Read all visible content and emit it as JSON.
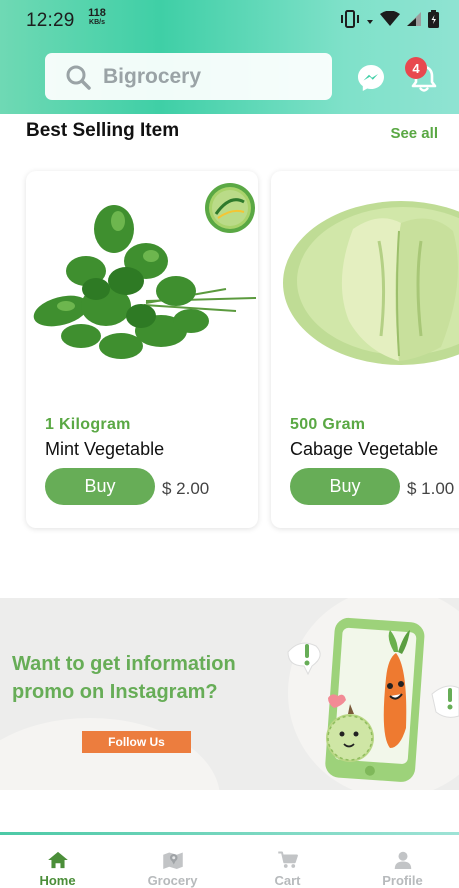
{
  "status_bar": {
    "time": "12:29",
    "net_speed_value": "118",
    "net_speed_unit": "KB/s"
  },
  "header": {
    "search_placeholder": "Bigrocery",
    "notification_count": "4"
  },
  "section": {
    "title": "Best Selling Item",
    "see_all": "See all"
  },
  "products": [
    {
      "weight": "1 Kilogram",
      "name": "Mint Vegetable",
      "buy_label": "Buy",
      "price": "$ 2.00",
      "badge_logo": "fresh-logo"
    },
    {
      "weight": "500 Gram",
      "name": "Cabage Vegetable",
      "buy_label": "Buy",
      "price": "$ 1.00"
    }
  ],
  "promo": {
    "title": "Want to get information promo on Instagram?",
    "button_label": "Follow Us"
  },
  "bottom_nav": [
    {
      "label": "Home",
      "icon": "home-icon",
      "active": true
    },
    {
      "label": "Grocery",
      "icon": "map-icon",
      "active": false
    },
    {
      "label": "Cart",
      "icon": "cart-icon",
      "active": false
    },
    {
      "label": "Profile",
      "icon": "profile-icon",
      "active": false
    }
  ],
  "colors": {
    "brand_green": "#67ad57",
    "header_teal": "#3fcfa6",
    "promo_button": "#ec7d3e",
    "badge_red": "#e8484f"
  }
}
